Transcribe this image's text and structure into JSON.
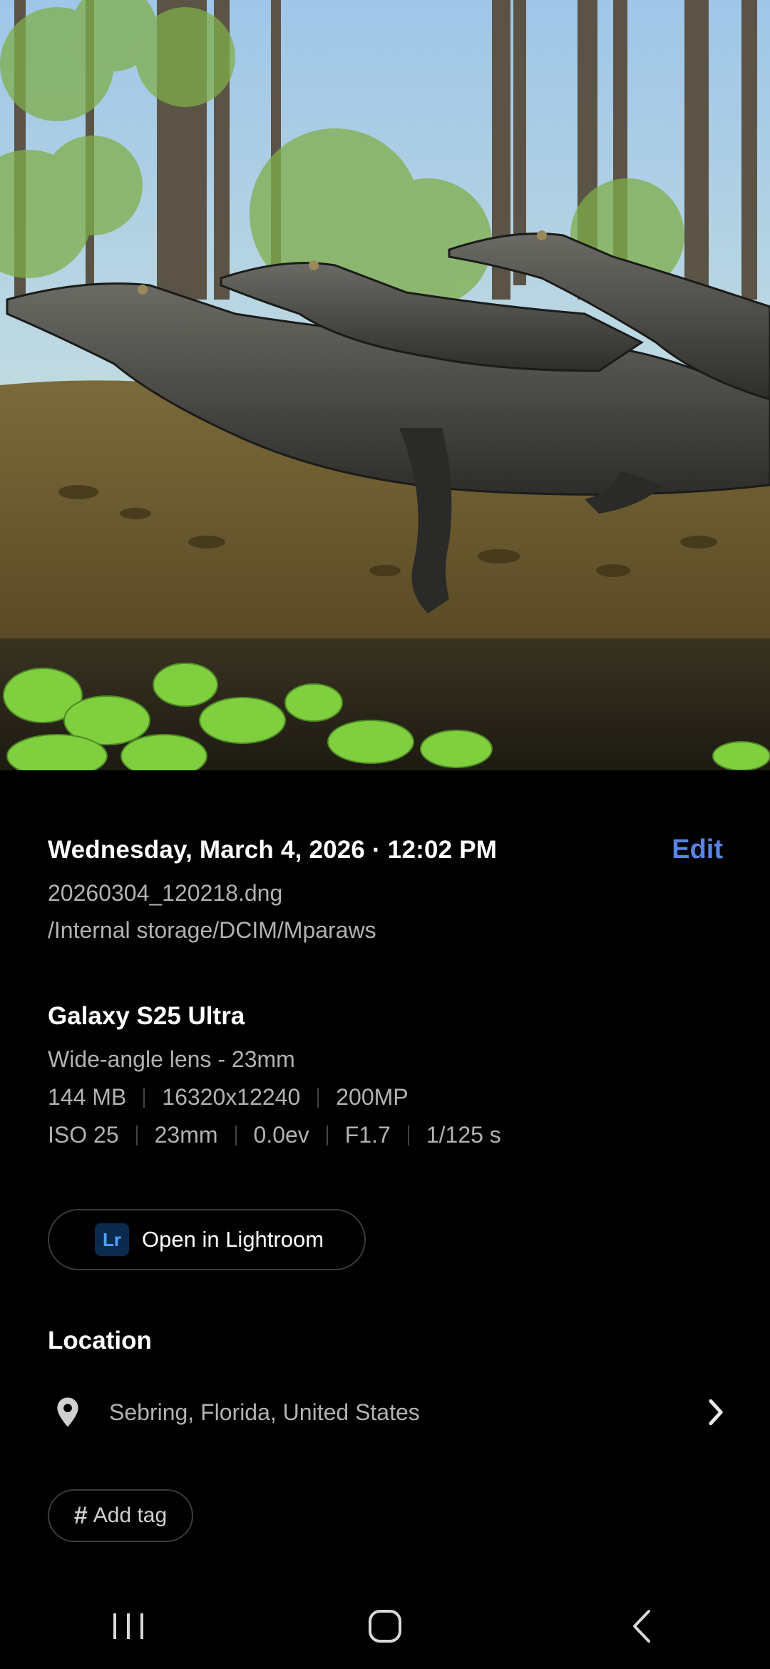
{
  "photo": {
    "subject": "alligators-on-log"
  },
  "details": {
    "datetime": "Wednesday, March 4, 2026 · 12:02 PM",
    "edit_label": "Edit",
    "filename": "20260304_120218.dng",
    "path": "/Internal storage/DCIM/Mparaws",
    "device": "Galaxy S25 Ultra",
    "lens": "Wide-angle lens - 23mm",
    "size_items": [
      "144 MB",
      "16320x12240",
      "200MP"
    ],
    "exposure_items": [
      "ISO 25",
      "23mm",
      "0.0ev",
      "F1.7",
      "1/125 s"
    ]
  },
  "lightroom": {
    "badge": "Lr",
    "label": "Open in Lightroom"
  },
  "location": {
    "title": "Location",
    "place": "Sebring, Florida, United States",
    "icon": "location-pin-icon"
  },
  "tags": {
    "hash": "#",
    "label": "Add tag"
  },
  "navbar": {
    "recent_icon": "recent-apps-icon",
    "home_icon": "home-icon",
    "back_icon": "back-icon"
  },
  "colors": {
    "background": "#000000",
    "accent_link": "#5a83e6",
    "muted_text": "#b2b2b2",
    "lr_badge_bg": "#0c2a4d",
    "lr_badge_text": "#4ea3ff"
  }
}
